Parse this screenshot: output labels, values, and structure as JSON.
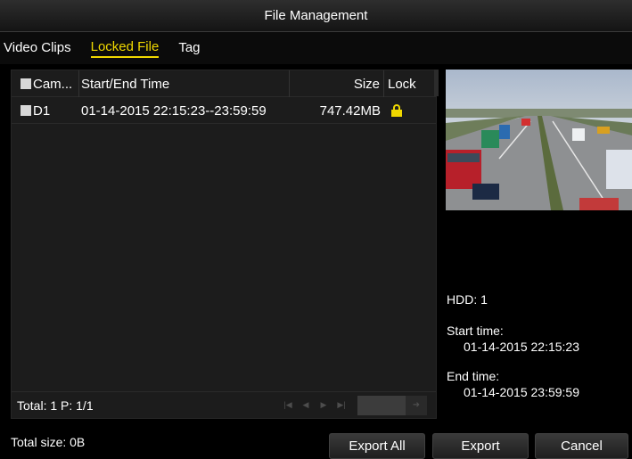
{
  "window": {
    "title": "File Management"
  },
  "tabs": [
    {
      "label": "Video Clips",
      "active": false
    },
    {
      "label": "Locked File",
      "active": true
    },
    {
      "label": "Tag",
      "active": false
    }
  ],
  "table": {
    "headers": {
      "camera": "Cam...",
      "time": "Start/End Time",
      "size": "Size",
      "lock": "Lock"
    },
    "rows": [
      {
        "camera": "D1",
        "time": "01-14-2015 22:15:23--23:59:59",
        "size": "747.42MB",
        "locked": true,
        "lock_icon": "lock-icon"
      }
    ]
  },
  "footer": {
    "total": "Total: 1  P: 1/1"
  },
  "pager": {
    "icons": [
      "first-page-icon",
      "prev-page-icon",
      "next-page-icon",
      "last-page-icon",
      "go-arrow-icon"
    ],
    "page_input": ""
  },
  "details": {
    "hdd": "HDD: 1",
    "start_label": "Start time:",
    "start_value": "01-14-2015 22:15:23",
    "end_label": "End time:",
    "end_value": "01-14-2015 23:59:59"
  },
  "bottom": {
    "total_size": "Total size: 0B",
    "export_all": "Export All",
    "export": "Export",
    "cancel": "Cancel"
  },
  "colors": {
    "accent": "#f0d800",
    "background": "#000000",
    "panel": "#1c1c1c"
  }
}
